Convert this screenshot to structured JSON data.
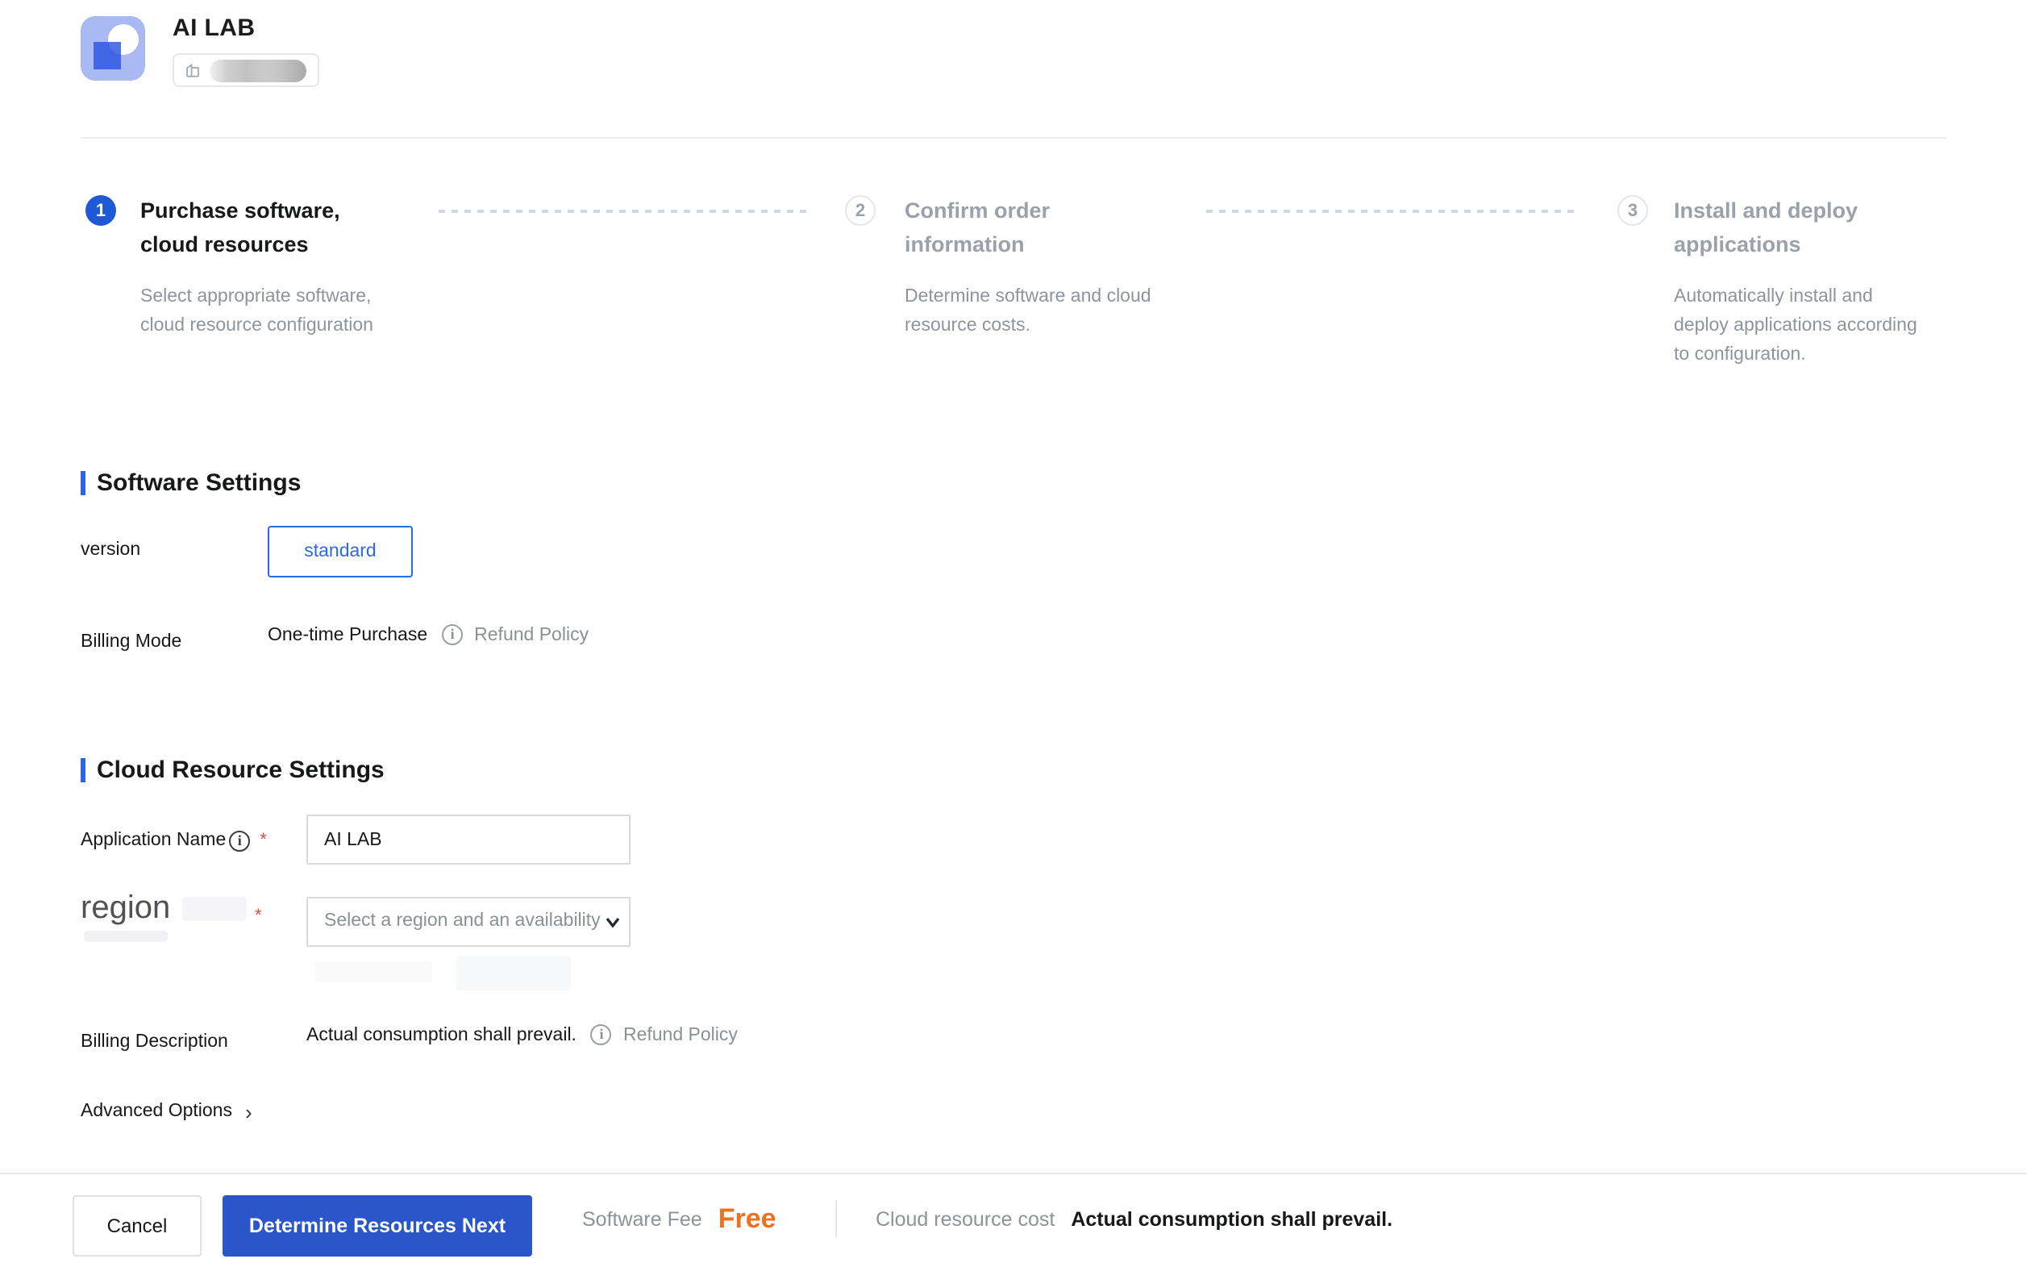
{
  "header": {
    "app_name": "AI LAB"
  },
  "stepper": {
    "steps": [
      {
        "number": "1",
        "state": "active",
        "title_lines": [
          "Purchase software,",
          "cloud resources"
        ],
        "desc_lines": [
          "Select appropriate software,",
          "cloud resource configuration",
          ""
        ]
      },
      {
        "number": "2",
        "state": "upcoming",
        "title_lines": [
          "Confirm order",
          "information"
        ],
        "desc_lines": [
          "Determine software and cloud",
          "resource costs.",
          ""
        ]
      },
      {
        "number": "3",
        "state": "upcoming",
        "title_lines": [
          "Install and deploy",
          "applications"
        ],
        "desc_lines": [
          "Automatically install and",
          "deploy applications according",
          "to configuration."
        ]
      }
    ]
  },
  "software_settings": {
    "heading": "Software Settings",
    "version_label": "version",
    "version_value": "standard",
    "billing_mode_label": "Billing Mode",
    "billing_mode_value": "One-time Purchase",
    "refund_policy_label": "Refund Policy"
  },
  "cloud_resource_settings": {
    "heading": "Cloud Resource Settings",
    "application_name_label": "Application Name",
    "application_name_value": "AI LAB",
    "region_label": "region",
    "region_placeholder": "Select a region and an availability",
    "billing_description_label": "Billing Description",
    "billing_description_value": "Actual consumption shall prevail.",
    "refund_policy_label": "Refund Policy",
    "advanced_options_label": "Advanced Options"
  },
  "footer": {
    "cancel_label": "Cancel",
    "next_label": "Determine Resources Next",
    "software_fee_label": "Software Fee",
    "software_fee_value": "Free",
    "cloud_cost_label": "Cloud resource cost",
    "cloud_cost_value": "Actual consumption shall prevail."
  },
  "colors": {
    "accent_button_blue": "#2a56ca",
    "step_active_blue": "#1e5ad8",
    "outline_blue": "#2b6ae9",
    "section_bar_blue": "#2b64e8",
    "free_orange": "#f1701f",
    "required_red": "#e54545",
    "logo_periwinkle": "#a9b9f1",
    "logo_blue": "#2e5ce0"
  }
}
